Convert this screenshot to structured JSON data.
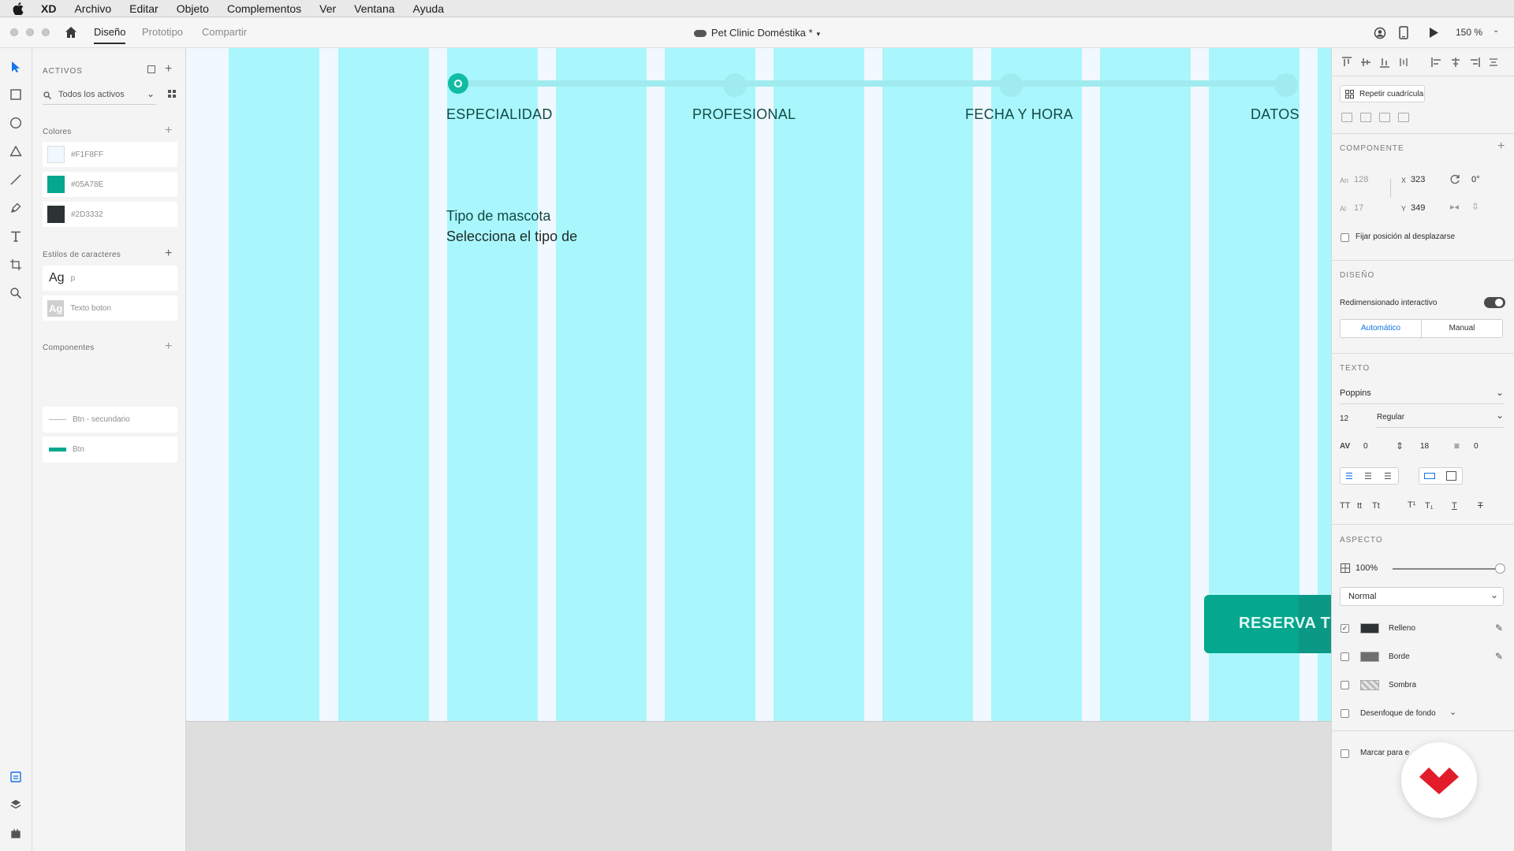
{
  "menubar": {
    "app": "XD",
    "items": [
      "Archivo",
      "Editar",
      "Objeto",
      "Complementos",
      "Ver",
      "Ventana",
      "Ayuda"
    ]
  },
  "titlebar": {
    "tabs": [
      "Diseño",
      "Prototipo",
      "Compartir"
    ],
    "active_tab": "Diseño",
    "document_title": "Pet Clinic Doméstika *",
    "zoom": "150 %"
  },
  "tools": [
    "select-icon",
    "rectangle-icon",
    "ellipse-icon",
    "polygon-icon",
    "line-icon",
    "pen-icon",
    "text-icon",
    "artboard-icon",
    "zoom-icon"
  ],
  "assets": {
    "title": "ACTIVOS",
    "search_placeholder": "Todos los activos",
    "colors_header": "Colores",
    "colors": [
      {
        "hex": "#F1F8FF",
        "label": "#F1F8FF"
      },
      {
        "hex": "#05A78E",
        "label": "#05A78E"
      },
      {
        "hex": "#2D3332",
        "label": "#2D3332"
      }
    ],
    "char_styles_header": "Estilos de caracteres",
    "char_styles": [
      {
        "sample": "Ag",
        "name": "p"
      },
      {
        "sample": "Ag",
        "name": "Texto boton"
      }
    ],
    "components_header": "Componentes",
    "components": [
      {
        "name": "Btn - secundario"
      },
      {
        "name": "Btn"
      }
    ]
  },
  "canvas": {
    "background": "#F1F8FF",
    "column_color": "#A9F7FC",
    "steps": [
      "ESPECIALIDAD",
      "PROFESIONAL",
      "FECHA Y HORA",
      "DATOS"
    ],
    "active_step": 0,
    "heading": "Tipo de mascota",
    "subheading": "Selecciona el tipo de",
    "cta_label": "RESERVA T",
    "cta_color": "#05A78E"
  },
  "properties": {
    "repeat_grid": "Repetir cuadrícula",
    "component_header": "COMPONENTE",
    "w_label": "An",
    "w_value": "128",
    "h_label": "Al",
    "h_value": "17",
    "x_label": "X",
    "x_value": "323",
    "y_label": "Y",
    "y_value": "349",
    "rotation": "0°",
    "fix_position": "Fijar posición al desplazarse",
    "design_header": "DISEÑO",
    "responsive_resize": "Redimensionado interactivo",
    "auto_tab": "Automático",
    "manual_tab": "Manual",
    "text_header": "TEXTO",
    "font_family": "Poppins",
    "font_size": "12",
    "font_weight": "Regular",
    "char_spacing": "0",
    "line_spacing": "18",
    "paragraph_spacing": "0",
    "appearance_header": "ASPECTO",
    "opacity": "100%",
    "opacity_fraction": 1.0,
    "blend_mode": "Normal",
    "fill_label": "Relleno",
    "fill_color": "#2D3332",
    "border_label": "Borde",
    "border_color": "#6E6E6E",
    "shadow_label": "Sombra",
    "bg_blur_label": "Desenfoque de fondo",
    "mark_export_label": "Marcar para e"
  }
}
